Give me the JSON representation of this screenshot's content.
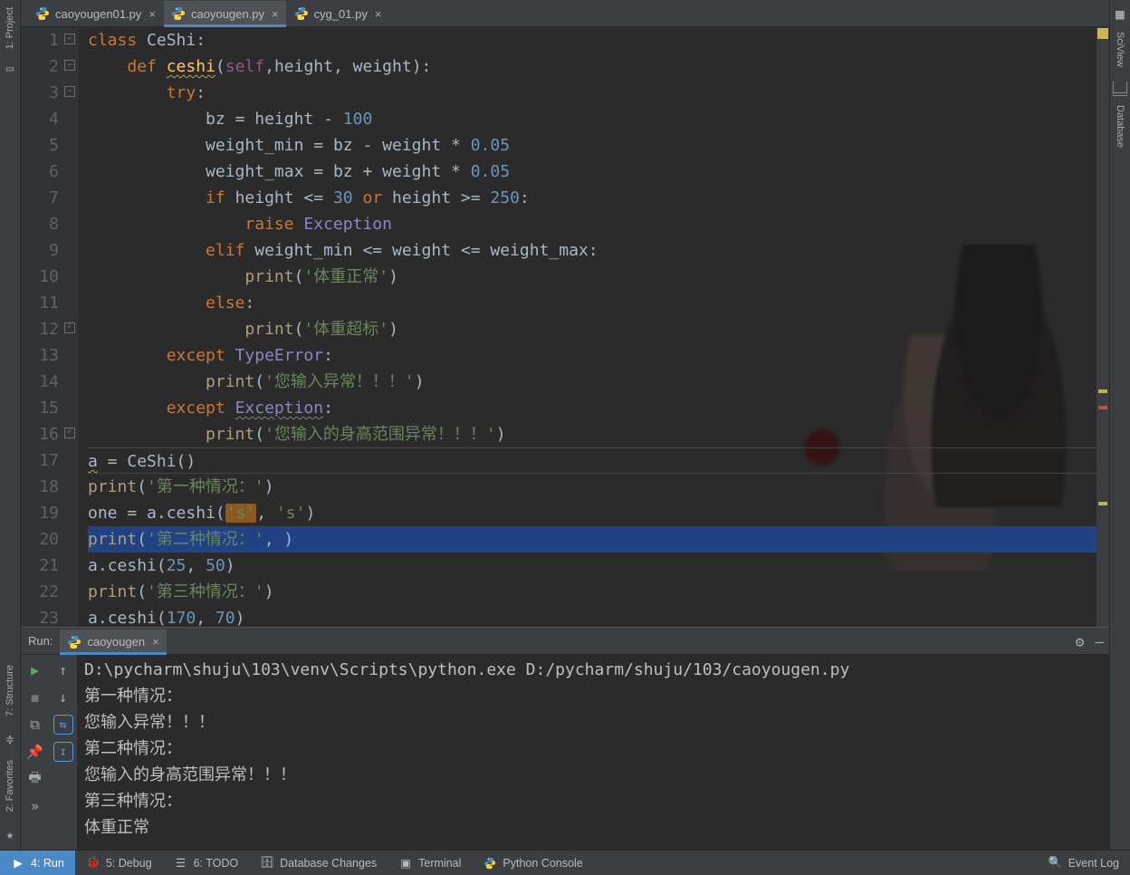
{
  "leftRail": {
    "project": "1: Project"
  },
  "rightRail": {
    "sciview": "SciView",
    "database": "Database"
  },
  "tabs": [
    {
      "label": "caoyougen01.py",
      "active": false
    },
    {
      "label": "caoyougen.py",
      "active": true
    },
    {
      "label": "cyg_01.py",
      "active": false
    }
  ],
  "code": {
    "lines": [
      {
        "n": 1,
        "fold": "minus"
      },
      {
        "n": 2,
        "fold": "minus"
      },
      {
        "n": 3,
        "fold": "minus"
      },
      {
        "n": 4
      },
      {
        "n": 5
      },
      {
        "n": 6
      },
      {
        "n": 7
      },
      {
        "n": 8
      },
      {
        "n": 9
      },
      {
        "n": 10
      },
      {
        "n": 11
      },
      {
        "n": 12,
        "fold": "end"
      },
      {
        "n": 13
      },
      {
        "n": 14
      },
      {
        "n": 15
      },
      {
        "n": 16,
        "fold": "end"
      },
      {
        "n": 17
      },
      {
        "n": 18
      },
      {
        "n": 19
      },
      {
        "n": 20
      },
      {
        "n": 21
      },
      {
        "n": 22
      },
      {
        "n": 23
      }
    ],
    "t": {
      "class": "class",
      "CeShi": "CeShi",
      "def": "def",
      "ceshi": "ceshi",
      "self": "self",
      "height": "height",
      "weight": "weight",
      "try": "try",
      "bz": "bz",
      "eq": " = ",
      "minus": " - ",
      "plus": " + ",
      "star": " * ",
      "hundred": "100",
      "p05": "0.05",
      "weight_min": "weight_min",
      "weight_max": "weight_max",
      "if": "if",
      "le": " <= ",
      "ge": " >= ",
      "v30": "30",
      "or": "or",
      "v250": "250",
      "raise": "raise",
      "Exception": "Exception",
      "elif": "elif",
      "print": "print",
      "else": "else",
      "except": "except",
      "TypeError": "TypeError",
      "s_normal": "'体重正常'",
      "s_over": "'体重超标'",
      "s_inerr": "'您输入异常！！！'",
      "s_herr": "'您输入的身高范围异常！！！'",
      "a": "a",
      "one": "one",
      "s_case1": "'第一种情况：'",
      "s_case2": "'第二种情况：'",
      "s_case3": "'第三种情况：'",
      "ss": "'s'",
      "v25": "25",
      "v50": "50",
      "v170": "170",
      "v70": "70",
      "comma_sp": ", "
    }
  },
  "run": {
    "title": "Run:",
    "tabLabel": "caoyougen",
    "lines": {
      "path": "D:\\pycharm\\shuju\\103\\venv\\Scripts\\python.exe D:/pycharm/shuju/103/caoyougen.py",
      "l1": "第一种情况：",
      "l2": "您输入异常！！！",
      "l3": "第二种情况：",
      "l4": "您输入的身高范围异常！！！",
      "l5": "第三种情况：",
      "l6": "体重正常"
    }
  },
  "status": {
    "run": "4: Run",
    "debug": "5: Debug",
    "todo": "6: TODO",
    "db": "Database Changes",
    "term": "Terminal",
    "pycon": "Python Console",
    "eventlog": "Event Log"
  }
}
